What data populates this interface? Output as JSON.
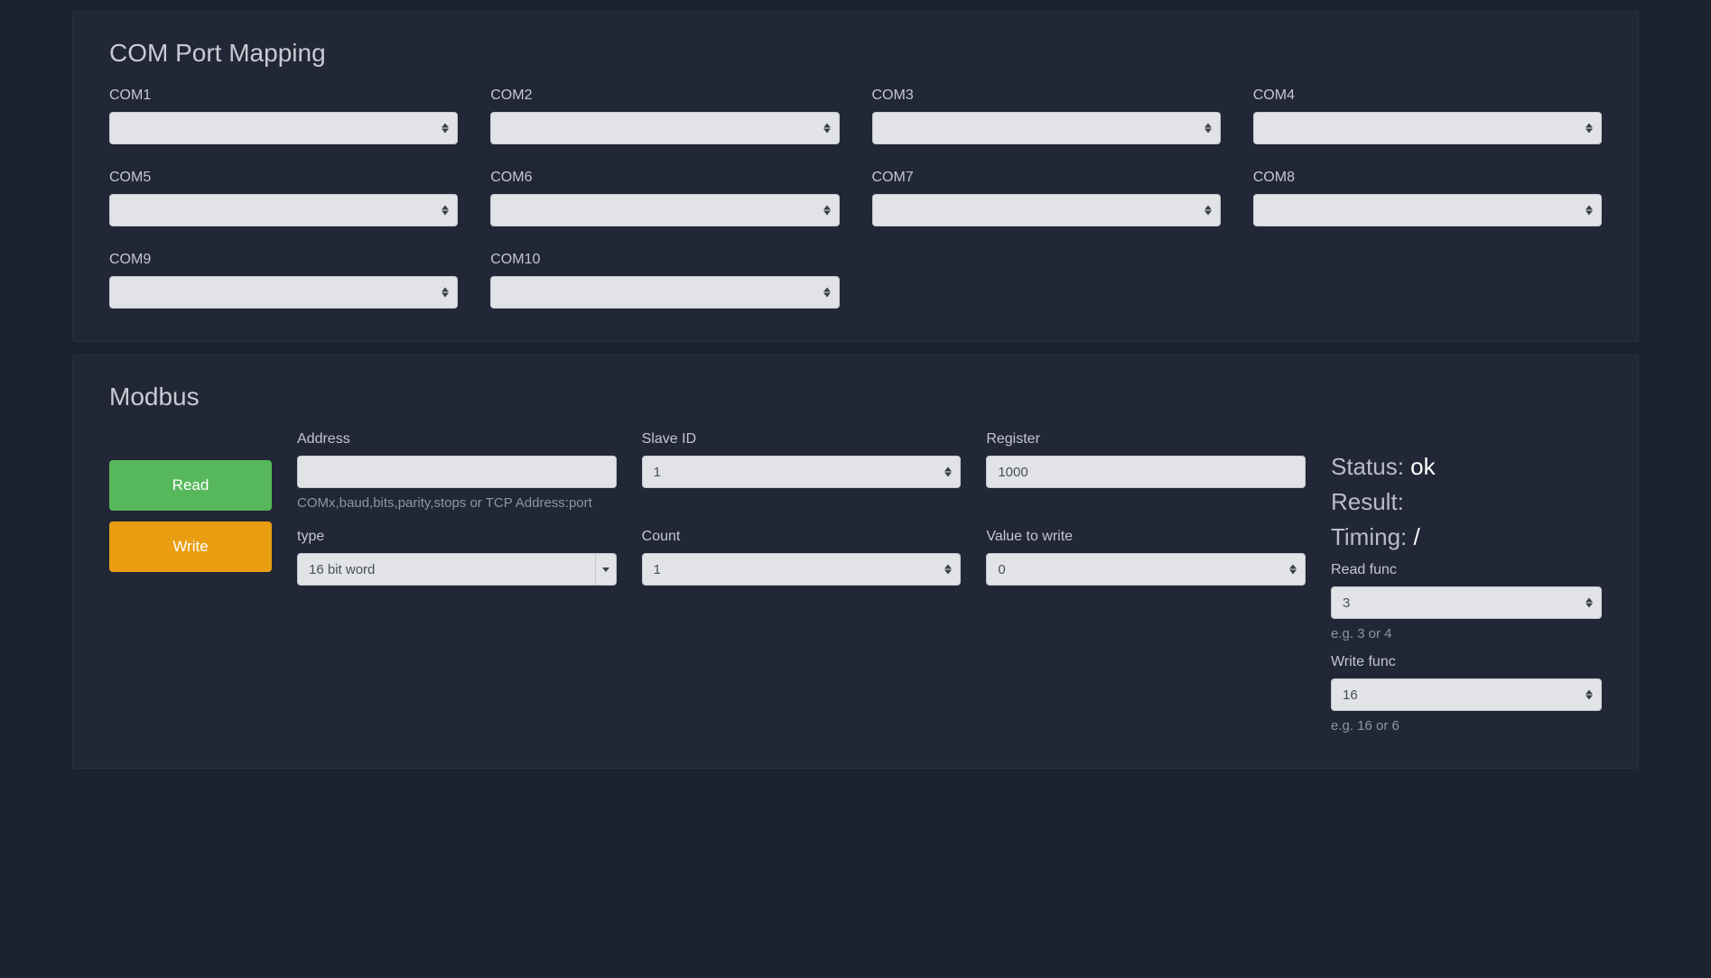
{
  "com_mapping": {
    "title": "COM Port Mapping",
    "ports": [
      {
        "label": "COM1",
        "value": ""
      },
      {
        "label": "COM2",
        "value": ""
      },
      {
        "label": "COM3",
        "value": ""
      },
      {
        "label": "COM4",
        "value": ""
      },
      {
        "label": "COM5",
        "value": ""
      },
      {
        "label": "COM6",
        "value": ""
      },
      {
        "label": "COM7",
        "value": ""
      },
      {
        "label": "COM8",
        "value": ""
      },
      {
        "label": "COM9",
        "value": ""
      },
      {
        "label": "COM10",
        "value": ""
      }
    ]
  },
  "modbus": {
    "title": "Modbus",
    "read_label": "Read",
    "write_label": "Write",
    "address": {
      "label": "Address",
      "value": "",
      "hint": "COMx,baud,bits,parity,stops or TCP Address:port"
    },
    "slave_id": {
      "label": "Slave ID",
      "value": "1"
    },
    "register": {
      "label": "Register",
      "value": "1000"
    },
    "type": {
      "label": "type",
      "value": "16 bit word"
    },
    "count": {
      "label": "Count",
      "value": "1"
    },
    "value_to_write": {
      "label": "Value to write",
      "value": "0"
    },
    "status": {
      "label": "Status: ",
      "value": "ok"
    },
    "result": {
      "label": "Result:",
      "value": ""
    },
    "timing": {
      "label": "Timing: ",
      "value": "/"
    },
    "read_func": {
      "label": "Read func",
      "value": "3",
      "hint": "e.g. 3 or 4"
    },
    "write_func": {
      "label": "Write func",
      "value": "16",
      "hint": "e.g. 16 or 6"
    }
  }
}
